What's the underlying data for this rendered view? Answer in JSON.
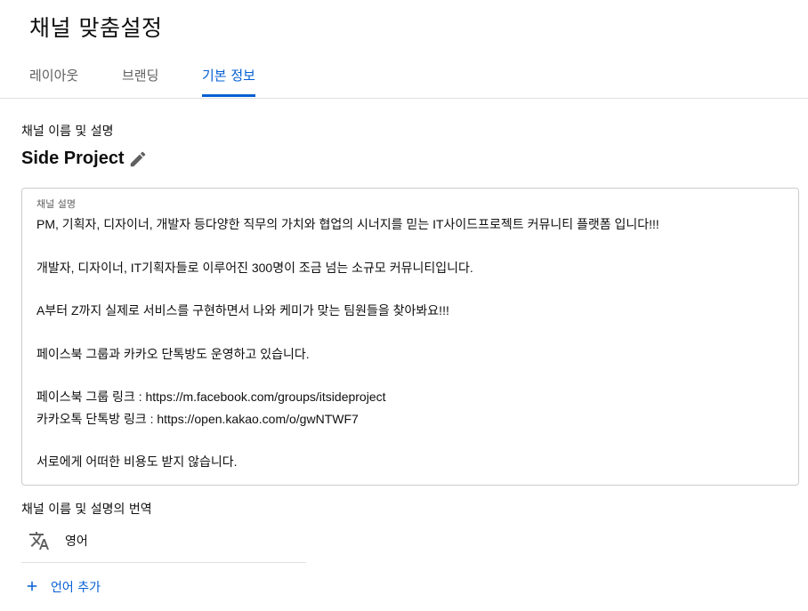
{
  "header": {
    "title": "채널 맞춤설정"
  },
  "tabs": [
    {
      "label": "레이아웃",
      "active": false
    },
    {
      "label": "브랜딩",
      "active": false
    },
    {
      "label": "기본 정보",
      "active": true
    }
  ],
  "basic_info": {
    "name_section_label": "채널 이름 및 설명",
    "channel_name": "Side Project",
    "description_caption": "채널 설명",
    "description": "PM, 기획자, 디자이너, 개발자 등다양한 직무의 가치와 협업의 시너지를 믿는 IT사이드프로젝트 커뮤니티 플랫폼 입니다!!!\n\n개발자, 디자이너, IT기획자들로 이루어진 300명이 조금 넘는 소규모 커뮤니티입니다.\n\nA부터 Z까지 실제로 서비스를 구현하면서 나와 케미가 맞는 팀원들을 찾아봐요!!!\n\n페이스북 그룹과 카카오 단톡방도 운영하고 있습니다.\n\n페이스북 그룹 링크 : https://m.facebook.com/groups/itsideproject\n카카오톡 단톡방 링크 : https://open.kakao.com/o/gwNTWF7\n\n서로에게 어떠한 비용도 받지 않습니다.",
    "translation_section_label": "채널 이름 및 설명의 번역",
    "languages": [
      {
        "name": "영어",
        "icon": "translate-icon"
      }
    ],
    "add_language_label": "언어 추가"
  },
  "colors": {
    "accent": "#065fd4",
    "text_primary": "#0f0f0f",
    "text_secondary": "#606060",
    "border": "#cccccc",
    "divider": "#e0e0e0"
  }
}
